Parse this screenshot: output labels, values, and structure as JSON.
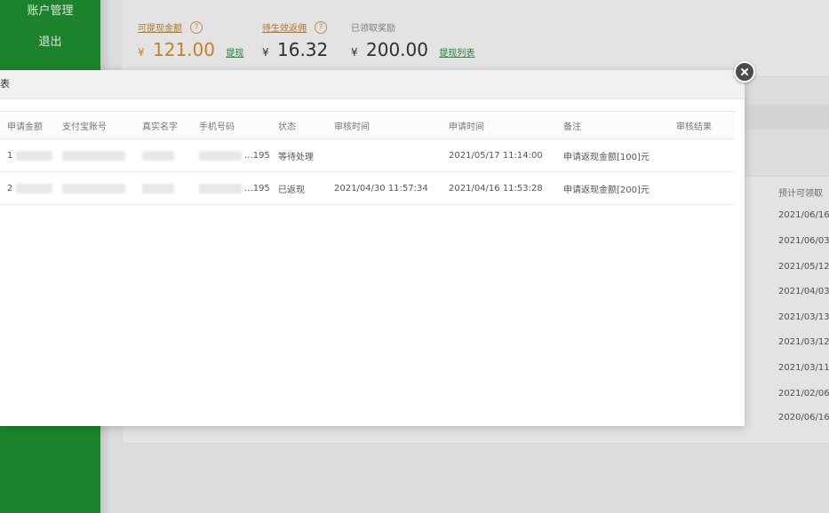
{
  "sidebar": {
    "items": [
      {
        "label": "账户管理"
      },
      {
        "label": "退出"
      }
    ]
  },
  "top": {
    "metrics": [
      {
        "label": "可提现金额",
        "currency": "¥",
        "amount": "121.00",
        "link": "提现"
      },
      {
        "label": "待生效返佣",
        "currency": "¥",
        "amount": "16.32",
        "link": ""
      },
      {
        "label": "已领取奖励",
        "currency": "¥",
        "amount": "200.00",
        "link": "提现列表"
      }
    ],
    "help_icon": "question-circle"
  },
  "background_list": {
    "header": "预计可领取",
    "dates": [
      "2021/06/16",
      "2021/06/03",
      "2021/05/12",
      "2021/04/03",
      "2021/03/13",
      "2021/03/12",
      "2021/03/11",
      "2021/02/06",
      "2020/06/16"
    ]
  },
  "modal": {
    "title": "表",
    "close_icon": "close-icon",
    "table": {
      "columns": [
        "申请金额",
        "支付宝账号",
        "真实名字",
        "手机号码",
        "状态",
        "审核时间",
        "申请时间",
        "备注",
        "审核结果"
      ],
      "rows": [
        {
          "amount": "1",
          "alipay": "",
          "name": "",
          "phone": "…195",
          "status": "等待处理",
          "review_time": "",
          "apply_time": "2021/05/17 11:14:00",
          "note": "申请返现金额[100]元",
          "result": ""
        },
        {
          "amount": "2",
          "alipay": "",
          "name": "",
          "phone": "…195",
          "status": "已返现",
          "review_time": "2021/04/30 11:57:34",
          "apply_time": "2021/04/16 11:53:28",
          "note": "申请返现金额[200]元",
          "result": ""
        }
      ]
    }
  }
}
